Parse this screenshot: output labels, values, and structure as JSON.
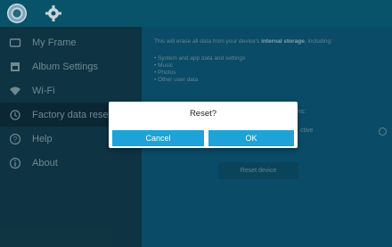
{
  "sidebar": {
    "items": [
      {
        "label": "My Frame",
        "icon": "frame-icon"
      },
      {
        "label": "Album Settings",
        "icon": "album-icon"
      },
      {
        "label": "Wi-Fi",
        "icon": "wifi-icon"
      },
      {
        "label": "Factory data reset",
        "icon": "reset-icon"
      },
      {
        "label": "Help",
        "icon": "help-icon"
      },
      {
        "label": "About",
        "icon": "info-icon"
      }
    ]
  },
  "main": {
    "warning_prefix": "This will erase all data from your device's ",
    "warning_bold": "internal storage",
    "warning_suffix": ", including:",
    "bullets": [
      "• System and app data and settings",
      "• Music",
      "• Photos",
      "• Other user data"
    ],
    "option_tail": "ns:",
    "option_active": "ctive",
    "reset_label": "Reset device"
  },
  "dialog": {
    "title": "Reset?",
    "cancel_label": "Cancel",
    "ok_label": "OK"
  },
  "colors": {
    "topbar": "#0a5b74",
    "sidebar": "#103848",
    "main": "#0b5270",
    "accent": "#1ea2d9"
  }
}
